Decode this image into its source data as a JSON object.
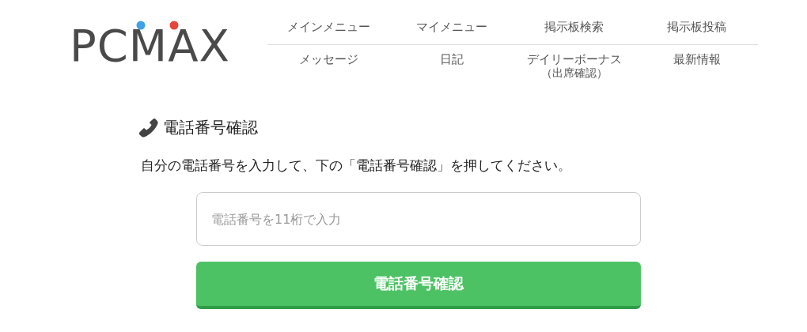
{
  "logo": {
    "text": "PCMAX"
  },
  "nav": [
    {
      "label": "メインメニュー"
    },
    {
      "label": "マイメニュー"
    },
    {
      "label": "掲示板検索"
    },
    {
      "label": "掲示板投稿"
    },
    {
      "label": "メッセージ"
    },
    {
      "label": "日記"
    },
    {
      "label": "デイリーボーナス",
      "sublabel": "（出席確認）"
    },
    {
      "label": "最新情報"
    }
  ],
  "heading": "電話番号確認",
  "instruction": "自分の電話番号を入力して、下の「電話番号確認」を押してください。",
  "phone_field": {
    "placeholder": "電話番号を11桁で入力"
  },
  "submit_button": "電話番号確認"
}
